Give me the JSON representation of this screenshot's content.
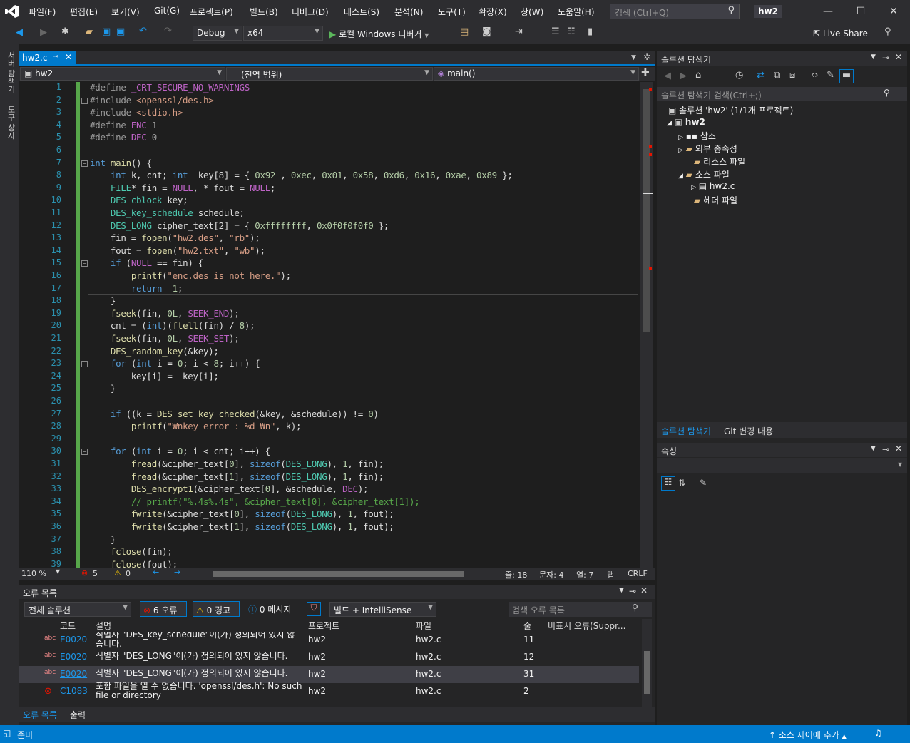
{
  "menu": [
    "파일(F)",
    "편집(E)",
    "보기(V)",
    "Git(G)",
    "프로젝트(P)",
    "빌드(B)",
    "디버그(D)",
    "테스트(S)",
    "분석(N)",
    "도구(T)",
    "확장(X)",
    "창(W)",
    "도움말(H)"
  ],
  "search": {
    "placeholder": "검색 (Ctrl+Q)"
  },
  "project_name": "hw2",
  "toolbar": {
    "config": "Debug",
    "platform": "x64",
    "debug_label": "로컬 Windows 디버거",
    "liveshare": "Live Share"
  },
  "leftstrip": {
    "a": "서버 탐색기",
    "b": "도구 상자"
  },
  "editor": {
    "tab_label": "hw2.c",
    "nav_project": "hw2",
    "nav_scope": "(전역 범위)",
    "nav_func": "main()",
    "lines": [
      [
        [
          "pp",
          "#define "
        ],
        [
          "mac",
          "_CRT_SECURE_NO_WARNINGS"
        ]
      ],
      [
        [
          "pp",
          "#include "
        ],
        [
          "str",
          "<openssl/des.h>"
        ]
      ],
      [
        [
          "pp",
          "#include "
        ],
        [
          "str",
          "<stdio.h>"
        ]
      ],
      [
        [
          "pp",
          "#define "
        ],
        [
          "mac",
          "ENC"
        ],
        [
          "pp",
          " 1"
        ]
      ],
      [
        [
          "pp",
          "#define "
        ],
        [
          "mac",
          "DEC"
        ],
        [
          "pp",
          " 0"
        ]
      ],
      [],
      [
        [
          "kw",
          "int "
        ],
        [
          "fn",
          "main"
        ],
        [
          "",
          "() {"
        ]
      ],
      [
        [
          "",
          "    "
        ],
        [
          "kw",
          "int "
        ],
        [
          "",
          "k, cnt; "
        ],
        [
          "kw",
          "int "
        ],
        [
          "",
          "_key[8] = { "
        ],
        [
          "num",
          "0x92"
        ],
        [
          "",
          " , "
        ],
        [
          "num",
          "0xec"
        ],
        [
          "",
          ", "
        ],
        [
          "num",
          "0x01"
        ],
        [
          "",
          ", "
        ],
        [
          "num",
          "0x58"
        ],
        [
          "",
          ", "
        ],
        [
          "num",
          "0xd6"
        ],
        [
          "",
          ", "
        ],
        [
          "num",
          "0x16"
        ],
        [
          "",
          ", "
        ],
        [
          "num",
          "0xae"
        ],
        [
          "",
          ", "
        ],
        [
          "num",
          "0x89"
        ],
        [
          "",
          " };"
        ]
      ],
      [
        [
          "",
          "    "
        ],
        [
          "ty",
          "FILE"
        ],
        [
          "",
          "* fin = "
        ],
        [
          "mac",
          "NULL"
        ],
        [
          "",
          ", * fout = "
        ],
        [
          "mac",
          "NULL"
        ],
        [
          "",
          ";"
        ]
      ],
      [
        [
          "",
          "    "
        ],
        [
          "ty",
          "DES_cblock"
        ],
        [
          "",
          " key;"
        ]
      ],
      [
        [
          "",
          "    "
        ],
        [
          "ty",
          "DES_key_schedule"
        ],
        [
          "",
          " schedule;"
        ]
      ],
      [
        [
          "",
          "    "
        ],
        [
          "ty",
          "DES_LONG"
        ],
        [
          "",
          " cipher_text[2] = { "
        ],
        [
          "num",
          "0xffffffff"
        ],
        [
          "",
          ", "
        ],
        [
          "num",
          "0x0f0f0f0f0"
        ],
        [
          "",
          " };"
        ]
      ],
      [
        [
          "",
          "    fin = "
        ],
        [
          "fn",
          "fopen"
        ],
        [
          "",
          "("
        ],
        [
          "str",
          "\"hw2.des\""
        ],
        [
          "",
          ", "
        ],
        [
          "str",
          "\"rb\""
        ],
        [
          "",
          ");"
        ]
      ],
      [
        [
          "",
          "    fout = "
        ],
        [
          "fn",
          "fopen"
        ],
        [
          "",
          "("
        ],
        [
          "str",
          "\"hw2.txt\""
        ],
        [
          "",
          ", "
        ],
        [
          "str",
          "\"wb\""
        ],
        [
          "",
          ");"
        ]
      ],
      [
        [
          "",
          "    "
        ],
        [
          "kw",
          "if "
        ],
        [
          "",
          "("
        ],
        [
          "mac",
          "NULL"
        ],
        [
          "",
          " == fin) {"
        ]
      ],
      [
        [
          "",
          "        "
        ],
        [
          "fn",
          "printf"
        ],
        [
          "",
          "("
        ],
        [
          "str",
          "\"enc.des is not here.\""
        ],
        [
          "",
          ");"
        ]
      ],
      [
        [
          "",
          "        "
        ],
        [
          "kw",
          "return "
        ],
        [
          "",
          "-"
        ],
        [
          "num",
          "1"
        ],
        [
          "",
          ";"
        ]
      ],
      [
        [
          "",
          "    }"
        ]
      ],
      [
        [
          "",
          "    "
        ],
        [
          "fn",
          "fseek"
        ],
        [
          "",
          "(fin, "
        ],
        [
          "num",
          "0L"
        ],
        [
          "",
          ", "
        ],
        [
          "mac",
          "SEEK_END"
        ],
        [
          "",
          ");"
        ]
      ],
      [
        [
          "",
          "    cnt = ("
        ],
        [
          "kw",
          "int"
        ],
        [
          "",
          ")("
        ],
        [
          "fn",
          "ftell"
        ],
        [
          "",
          "(fin) / "
        ],
        [
          "num",
          "8"
        ],
        [
          "",
          ");"
        ]
      ],
      [
        [
          "",
          "    "
        ],
        [
          "fn",
          "fseek"
        ],
        [
          "",
          "(fin, "
        ],
        [
          "num",
          "0L"
        ],
        [
          "",
          ", "
        ],
        [
          "mac",
          "SEEK_SET"
        ],
        [
          "",
          ");"
        ]
      ],
      [
        [
          "",
          "    "
        ],
        [
          "fn",
          "DES_random_key"
        ],
        [
          "",
          "(&key);"
        ]
      ],
      [
        [
          "",
          "    "
        ],
        [
          "kw",
          "for "
        ],
        [
          "",
          "("
        ],
        [
          "kw",
          "int "
        ],
        [
          "",
          "i = "
        ],
        [
          "num",
          "0"
        ],
        [
          "",
          "; i < "
        ],
        [
          "num",
          "8"
        ],
        [
          "",
          "; i++) {"
        ]
      ],
      [
        [
          "",
          "        key[i] = _key[i];"
        ]
      ],
      [
        [
          "",
          "    }"
        ]
      ],
      [],
      [
        [
          "",
          "    "
        ],
        [
          "kw",
          "if "
        ],
        [
          "",
          "((k = "
        ],
        [
          "fn",
          "DES_set_key_checked"
        ],
        [
          "",
          "(&key, &schedule)) != "
        ],
        [
          "num",
          "0"
        ],
        [
          "",
          ")"
        ]
      ],
      [
        [
          "",
          "        "
        ],
        [
          "fn",
          "printf"
        ],
        [
          "",
          "("
        ],
        [
          "str",
          "\"₩nkey error : %d ₩n\""
        ],
        [
          "",
          ", k);"
        ]
      ],
      [],
      [
        [
          "",
          "    "
        ],
        [
          "kw",
          "for "
        ],
        [
          "",
          "("
        ],
        [
          "kw",
          "int "
        ],
        [
          "",
          "i = "
        ],
        [
          "num",
          "0"
        ],
        [
          "",
          "; i < cnt; i++) {"
        ]
      ],
      [
        [
          "",
          "        "
        ],
        [
          "fn",
          "fread"
        ],
        [
          "",
          "(&cipher_text["
        ],
        [
          "num",
          "0"
        ],
        [
          "",
          "], "
        ],
        [
          "kw",
          "sizeof"
        ],
        [
          "",
          "("
        ],
        [
          "ty",
          "DES_LONG"
        ],
        [
          "",
          "), "
        ],
        [
          "num",
          "1"
        ],
        [
          "",
          ", fin);"
        ]
      ],
      [
        [
          "",
          "        "
        ],
        [
          "fn",
          "fread"
        ],
        [
          "",
          "(&cipher_text["
        ],
        [
          "num",
          "1"
        ],
        [
          "",
          "], "
        ],
        [
          "kw",
          "sizeof"
        ],
        [
          "",
          "("
        ],
        [
          "ty",
          "DES_LONG"
        ],
        [
          "",
          "), "
        ],
        [
          "num",
          "1"
        ],
        [
          "",
          ", fin);"
        ]
      ],
      [
        [
          "",
          "        "
        ],
        [
          "fn",
          "DES_encrypt1"
        ],
        [
          "",
          "(&cipher_text["
        ],
        [
          "num",
          "0"
        ],
        [
          "",
          "], &schedule, "
        ],
        [
          "mac",
          "DEC"
        ],
        [
          "",
          ");"
        ]
      ],
      [
        [
          "",
          "        "
        ],
        [
          "cm",
          "// printf(\"%.4s%.4s\", &cipher_text[0], &cipher_text[1]);"
        ]
      ],
      [
        [
          "",
          "        "
        ],
        [
          "fn",
          "fwrite"
        ],
        [
          "",
          "(&cipher_text["
        ],
        [
          "num",
          "0"
        ],
        [
          "",
          "], "
        ],
        [
          "kw",
          "sizeof"
        ],
        [
          "",
          "("
        ],
        [
          "ty",
          "DES_LONG"
        ],
        [
          "",
          "), "
        ],
        [
          "num",
          "1"
        ],
        [
          "",
          ", fout);"
        ]
      ],
      [
        [
          "",
          "        "
        ],
        [
          "fn",
          "fwrite"
        ],
        [
          "",
          "(&cipher_text["
        ],
        [
          "num",
          "1"
        ],
        [
          "",
          "], "
        ],
        [
          "kw",
          "sizeof"
        ],
        [
          "",
          "("
        ],
        [
          "ty",
          "DES_LONG"
        ],
        [
          "",
          "), "
        ],
        [
          "num",
          "1"
        ],
        [
          "",
          ", fout);"
        ]
      ],
      [
        [
          "",
          "    }"
        ]
      ],
      [
        [
          "",
          "    "
        ],
        [
          "fn",
          "fclose"
        ],
        [
          "",
          "(fin);"
        ]
      ],
      [
        [
          "",
          "    "
        ],
        [
          "fn",
          "fclose"
        ],
        [
          "",
          "(fout);"
        ]
      ]
    ]
  },
  "editor_status": {
    "zoom": "110 %",
    "errors": "5",
    "warnings": "0",
    "line": "줄: 18",
    "col": "문자: 4",
    "column": "열: 7",
    "tab": "탭",
    "eol": "CRLF"
  },
  "solution": {
    "title": "솔루션 탐색기",
    "search": "솔루션 탐색기 검색(Ctrl+;)",
    "root": "솔루션 'hw2' (1/1개 프로젝트)",
    "project": "hw2",
    "nodes": [
      "참조",
      "외부 종속성",
      "리소스 파일",
      "소스 파일",
      "hw2.c",
      "헤더 파일"
    ],
    "tabs": [
      "솔루션 탐색기",
      "Git 변경 내용"
    ]
  },
  "properties": {
    "title": "속성"
  },
  "errors": {
    "title": "오류 목록",
    "scope": "전체 솔루션",
    "err_btn": "6 오류",
    "warn_btn": "0 경고",
    "msg_btn": "0 메시지",
    "filter": "빌드 + IntelliSense",
    "search": "검색 오류 목록",
    "headers": [
      "코드",
      "설명",
      "프로젝트",
      "파일",
      "줄",
      "비표시 오류(Suppr..."
    ],
    "rows": [
      {
        "code": "E0020",
        "desc": "식별자 \"DES_key_schedule\"이(가) 정의되어 있지 않습니다.",
        "project": "hw2",
        "file": "hw2.c",
        "line": "11"
      },
      {
        "code": "E0020",
        "desc": "식별자 \"DES_LONG\"이(가) 정의되어 있지 않습니다.",
        "project": "hw2",
        "file": "hw2.c",
        "line": "12"
      },
      {
        "code": "E0020",
        "desc": "식별자 \"DES_LONG\"이(가) 정의되어 있지 않습니다.",
        "project": "hw2",
        "file": "hw2.c",
        "line": "31"
      },
      {
        "code": "C1083",
        "desc": "포함 파일을 열 수 없습니다. 'openssl/des.h': No such file or directory",
        "project": "hw2",
        "file": "hw2.c",
        "line": "2"
      }
    ],
    "bottom_tabs": [
      "오류 목록",
      "출력"
    ]
  },
  "status": {
    "ready": "준비",
    "source_control": "소스 제어에 추가"
  }
}
